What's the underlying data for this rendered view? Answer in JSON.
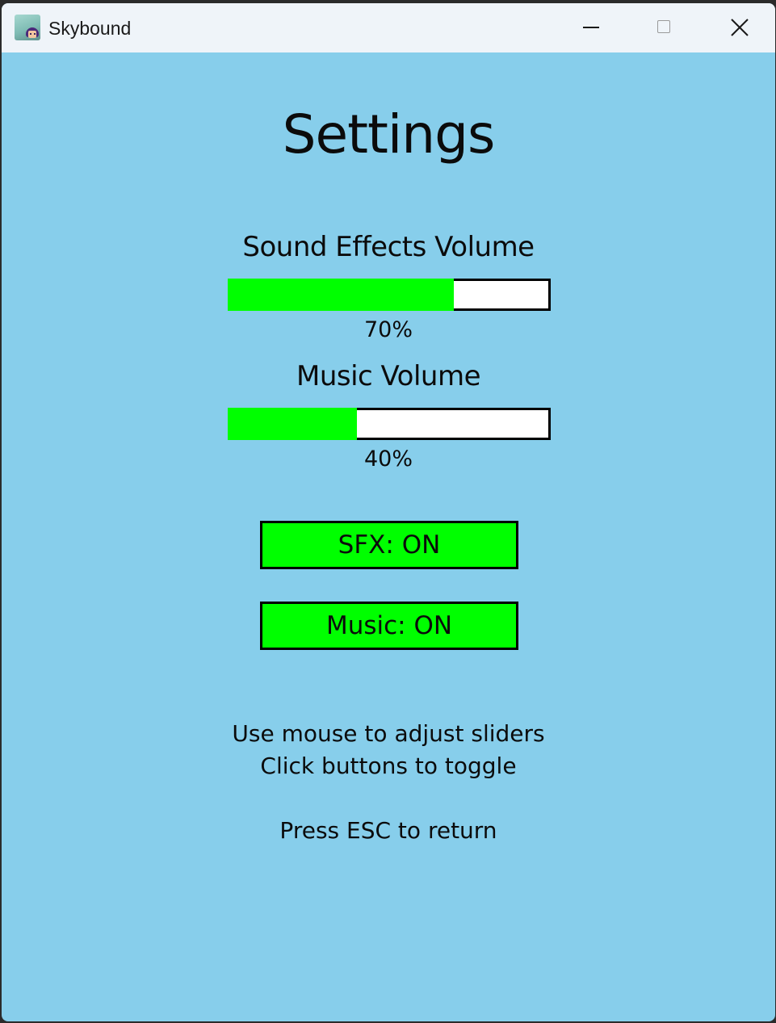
{
  "window": {
    "title": "Skybound",
    "icon": "skybound-app-icon",
    "controls": {
      "minimize_icon": "minimize-icon",
      "maximize_icon": "maximize-icon",
      "close_icon": "close-icon"
    },
    "background_color": "#87ceeb",
    "titlebar_color": "#eff4f9"
  },
  "settings": {
    "heading": "Settings",
    "sfx_volume": {
      "label": "Sound Effects Volume",
      "value": 0.7,
      "display": "70%"
    },
    "music_volume": {
      "label": "Music Volume",
      "value": 0.4,
      "display": "40%"
    },
    "toggles": {
      "sfx": "SFX: ON",
      "music": "Music: ON"
    },
    "colors": {
      "fill": "#00ff00",
      "track": "#ffffff",
      "border": "#000000"
    }
  },
  "help": {
    "line1": "Use mouse to adjust sliders",
    "line2": "Click buttons to toggle",
    "line3": "Press ESC to return"
  }
}
